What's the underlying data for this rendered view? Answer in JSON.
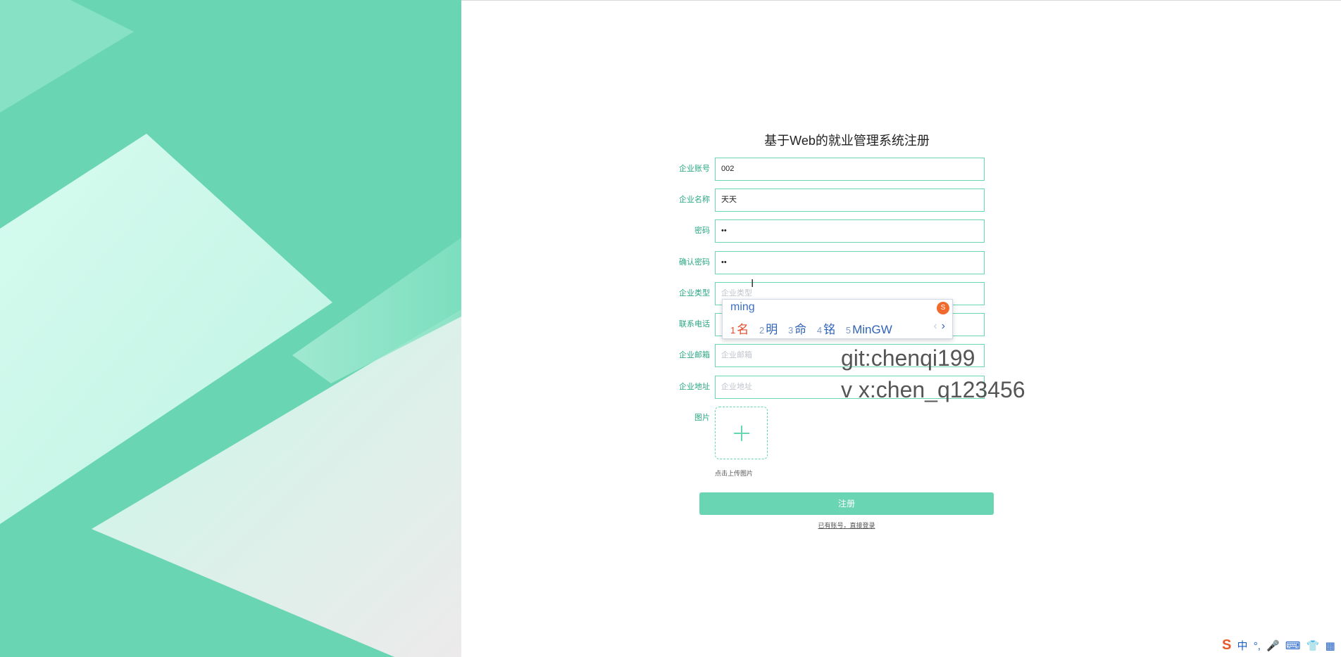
{
  "title": "基于Web的就业管理系统注册",
  "fields": [
    {
      "label": "企业账号",
      "value": "002",
      "placeholder": ""
    },
    {
      "label": "企业名称",
      "value": "天天",
      "placeholder": ""
    },
    {
      "label": "密码",
      "value": "••",
      "placeholder": ""
    },
    {
      "label": "确认密码",
      "value": "••",
      "placeholder": ""
    },
    {
      "label": "企业类型",
      "value": "",
      "placeholder": "企业类型"
    },
    {
      "label": "联系电话",
      "value": "",
      "placeholder": ""
    },
    {
      "label": "企业邮箱",
      "value": "",
      "placeholder": "企业邮箱"
    },
    {
      "label": "企业地址",
      "value": "",
      "placeholder": "企业地址"
    }
  ],
  "upload": {
    "label": "图片",
    "hint": "点击上传图片"
  },
  "register_label": "注册",
  "login_link": "已有账号，直接登录",
  "watermark": {
    "line1": "git:chenqi199",
    "line2": "v x:chen_q123456"
  },
  "ime": {
    "pinyin": "ming",
    "candidates": [
      {
        "idx": "1",
        "text": "名"
      },
      {
        "idx": "2",
        "text": "明"
      },
      {
        "idx": "3",
        "text": "命"
      },
      {
        "idx": "4",
        "text": "铭"
      },
      {
        "idx": "5",
        "text": "MinGW"
      }
    ],
    "prev": "‹",
    "next": "›"
  },
  "tray": {
    "lang": "中",
    "punct": "°,"
  },
  "colors": {
    "accent": "#6ad5b2",
    "label": "#2aa883"
  }
}
